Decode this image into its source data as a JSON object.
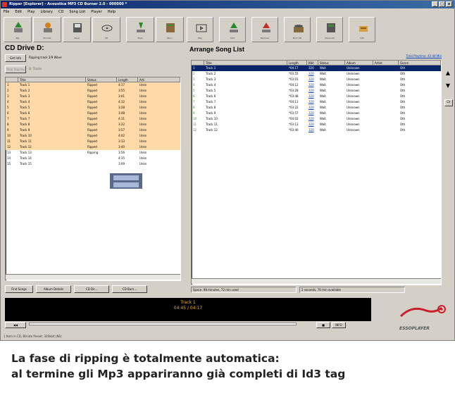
{
  "window": {
    "title": "Ripper [Explorer] - Acoustica MP3 CD Burner 2.0 - 000000 *",
    "controls": [
      "_",
      "□",
      "x"
    ]
  },
  "menu": [
    "File",
    "Edit",
    "Play",
    "Library",
    "CD",
    "Song List",
    "Player",
    "Help"
  ],
  "left_toolbar": [
    {
      "label": "Rip",
      "icon": "rip-icon"
    },
    {
      "label": "Encode",
      "icon": "encode-icon"
    },
    {
      "label": "Save",
      "icon": "save-icon"
    },
    {
      "label": "CD",
      "icon": "cd-icon"
    },
    {
      "label": "Tools",
      "icon": "tools-icon"
    },
    {
      "label": "Burn",
      "icon": "burn-icon"
    }
  ],
  "right_toolbar": [
    {
      "label": "Play",
      "icon": "play-icon"
    },
    {
      "label": "Add",
      "icon": "add-icon"
    },
    {
      "label": "Remove",
      "icon": "remove-icon"
    },
    {
      "label": "Burn CD",
      "icon": "burn-cd-icon"
    },
    {
      "label": "Save List",
      "icon": "save-list-icon"
    },
    {
      "label": "Info",
      "icon": "info-icon"
    }
  ],
  "cd_panel": {
    "title": "CD Drive D:",
    "rip_button": "Get Info",
    "status": "Ripping track 2/9 Wave",
    "stop_button": "Stop Ripping",
    "drive_field": "D:  Tracks",
    "columns": [
      "",
      "Title",
      "Status",
      "Length",
      "Arti"
    ],
    "tracks": [
      {
        "n": "1",
        "title": "Track 1",
        "status": "Ripped",
        "length": "4:17",
        "artist": "Unkn",
        "hl": true
      },
      {
        "n": "2",
        "title": "Track 2",
        "status": "Ripped",
        "length": "3:55",
        "artist": "Unkn",
        "hl": true
      },
      {
        "n": "3",
        "title": "Track 3",
        "status": "Ripped",
        "length": "3:01",
        "artist": "Unkn",
        "hl": true
      },
      {
        "n": "4",
        "title": "Track 4",
        "status": "Ripped",
        "length": "4:12",
        "artist": "Unkn",
        "hl": true
      },
      {
        "n": "5",
        "title": "Track 5",
        "status": "Ripped",
        "length": "3:28",
        "artist": "Unkn",
        "hl": true
      },
      {
        "n": "6",
        "title": "Track 6",
        "status": "Ripped",
        "length": "3:48",
        "artist": "Unkn",
        "hl": true
      },
      {
        "n": "7",
        "title": "Track 7",
        "status": "Ripped",
        "length": "4:11",
        "artist": "Unkn",
        "hl": true
      },
      {
        "n": "8",
        "title": "Track 8",
        "status": "Ripped",
        "length": "3:22",
        "artist": "Unkn",
        "hl": true
      },
      {
        "n": "9",
        "title": "Track 9",
        "status": "Ripped",
        "length": "3:57",
        "artist": "Unkn",
        "hl": true
      },
      {
        "n": "10",
        "title": "Track 10",
        "status": "Ripped",
        "length": "4:02",
        "artist": "Unkn",
        "hl": true
      },
      {
        "n": "11",
        "title": "Track 11",
        "status": "Ripped",
        "length": "3:13",
        "artist": "Unkn",
        "hl": true
      },
      {
        "n": "12",
        "title": "Track 12",
        "status": "Ripped",
        "length": "3:40",
        "artist": "Unkn",
        "hl": true
      },
      {
        "n": "13",
        "title": "Track 13",
        "status": "Ripping",
        "length": "3:56",
        "artist": "Unkn",
        "hl": false
      },
      {
        "n": "14",
        "title": "Track 14",
        "status": "",
        "length": "4:35",
        "artist": "Unkn",
        "hl": false
      },
      {
        "n": "15",
        "title": "Track 15",
        "status": "",
        "length": "3:09",
        "artist": "Unkn",
        "hl": false
      }
    ],
    "bottom_buttons": [
      "Find Songs",
      "Album Details",
      "CD Dir...",
      "CD Burn..."
    ]
  },
  "song_list": {
    "title": "Arrange Song List",
    "link": "Total Playtime: 42:48 Min",
    "columns": [
      "",
      "Title",
      "Length",
      "Kbit",
      "Status",
      "Album",
      "Artist",
      "Genre"
    ],
    "songs": [
      {
        "n": "1",
        "title": "Track 1",
        "length": "*04:17",
        "kbit": "320",
        "status": "Wait",
        "album": "Unknown",
        "artist": "",
        "genre": "Oth"
      },
      {
        "n": "2",
        "title": "Track 2",
        "length": "*03:55",
        "kbit": "320",
        "status": "Wait",
        "album": "Unknown",
        "artist": "",
        "genre": "Oth"
      },
      {
        "n": "3",
        "title": "Track 3",
        "length": "*03:01",
        "kbit": "320",
        "status": "Wait",
        "album": "Unknown",
        "artist": "",
        "genre": "Oth"
      },
      {
        "n": "4",
        "title": "Track 4",
        "length": "*04:12",
        "kbit": "320",
        "status": "Wait",
        "album": "Unknown",
        "artist": "",
        "genre": "Oth"
      },
      {
        "n": "5",
        "title": "Track 5",
        "length": "*03:28",
        "kbit": "320",
        "status": "Wait",
        "album": "Unknown",
        "artist": "",
        "genre": "Oth"
      },
      {
        "n": "6",
        "title": "Track 6",
        "length": "*03:48",
        "kbit": "320",
        "status": "Wait",
        "album": "Unknown",
        "artist": "",
        "genre": "Oth"
      },
      {
        "n": "7",
        "title": "Track 7",
        "length": "*04:11",
        "kbit": "320",
        "status": "Wait",
        "album": "Unknown",
        "artist": "",
        "genre": "Oth"
      },
      {
        "n": "8",
        "title": "Track 8",
        "length": "*03:22",
        "kbit": "320",
        "status": "Wait",
        "album": "Unknown",
        "artist": "",
        "genre": "Oth"
      },
      {
        "n": "9",
        "title": "Track 9",
        "length": "*03:57",
        "kbit": "320",
        "status": "Wait",
        "album": "Unknown",
        "artist": "",
        "genre": "Oth"
      },
      {
        "n": "10",
        "title": "Track 10",
        "length": "*04:02",
        "kbit": "320",
        "status": "Wait",
        "album": "Unknown",
        "artist": "",
        "genre": "Oth"
      },
      {
        "n": "11",
        "title": "Track 11",
        "length": "*03:13",
        "kbit": "320",
        "status": "Wait",
        "album": "Unknown",
        "artist": "",
        "genre": "Oth"
      },
      {
        "n": "12",
        "title": "Track 12",
        "length": "*03:40",
        "kbit": "320",
        "status": "Wait",
        "album": "Unknown",
        "artist": "",
        "genre": "Oth"
      }
    ],
    "status_left": "Space: 98 minutes, 72 min used",
    "status_right": "2 seconds, 70 min available",
    "side_buttons": [
      "▲",
      "▼",
      "Clr"
    ]
  },
  "player": {
    "track": "Track 1",
    "time": "04:45 / 04:17",
    "prev_button": "◀◀",
    "next_button": "▶▶",
    "logo_text": "ESSOPLAYER",
    "stop_button": "■",
    "mode_button": "INFO"
  },
  "statusbar": "1 Item in CD, Bitrate Preset: 320kbit (NS)",
  "caption": {
    "line1": "La fase di ripping è totalmente automatica:",
    "line2": "al termine gli Mp3 appariranno già completi di Id3 tag"
  }
}
